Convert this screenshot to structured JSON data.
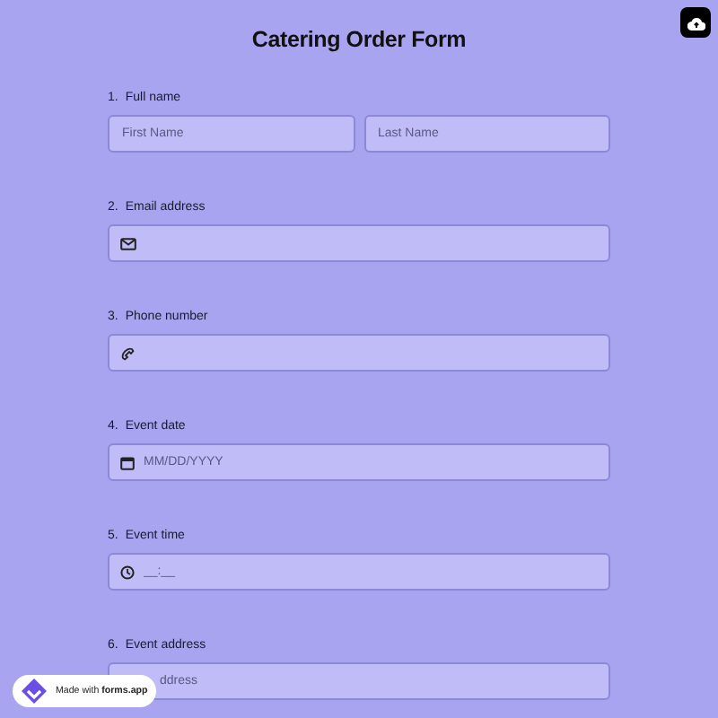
{
  "title": "Catering Order Form",
  "questions": [
    {
      "number": "1.",
      "label": "Full name",
      "kind": "name",
      "fields": [
        {
          "placeholder": "First Name"
        },
        {
          "placeholder": "Last Name"
        }
      ]
    },
    {
      "number": "2.",
      "label": "Email address",
      "kind": "email"
    },
    {
      "number": "3.",
      "label": "Phone number",
      "kind": "phone"
    },
    {
      "number": "4.",
      "label": "Event date",
      "kind": "date",
      "fields": [
        {
          "placeholder": "MM/DD/YYYY"
        }
      ]
    },
    {
      "number": "5.",
      "label": "Event time",
      "kind": "time",
      "fields": [
        {
          "placeholder": "__:__"
        }
      ]
    },
    {
      "number": "6.",
      "label": "Event address",
      "kind": "covered",
      "fields": [
        {
          "placeholder": "ddress"
        }
      ]
    }
  ],
  "badge": {
    "prefix": "Made with ",
    "brand": "forms.app"
  }
}
